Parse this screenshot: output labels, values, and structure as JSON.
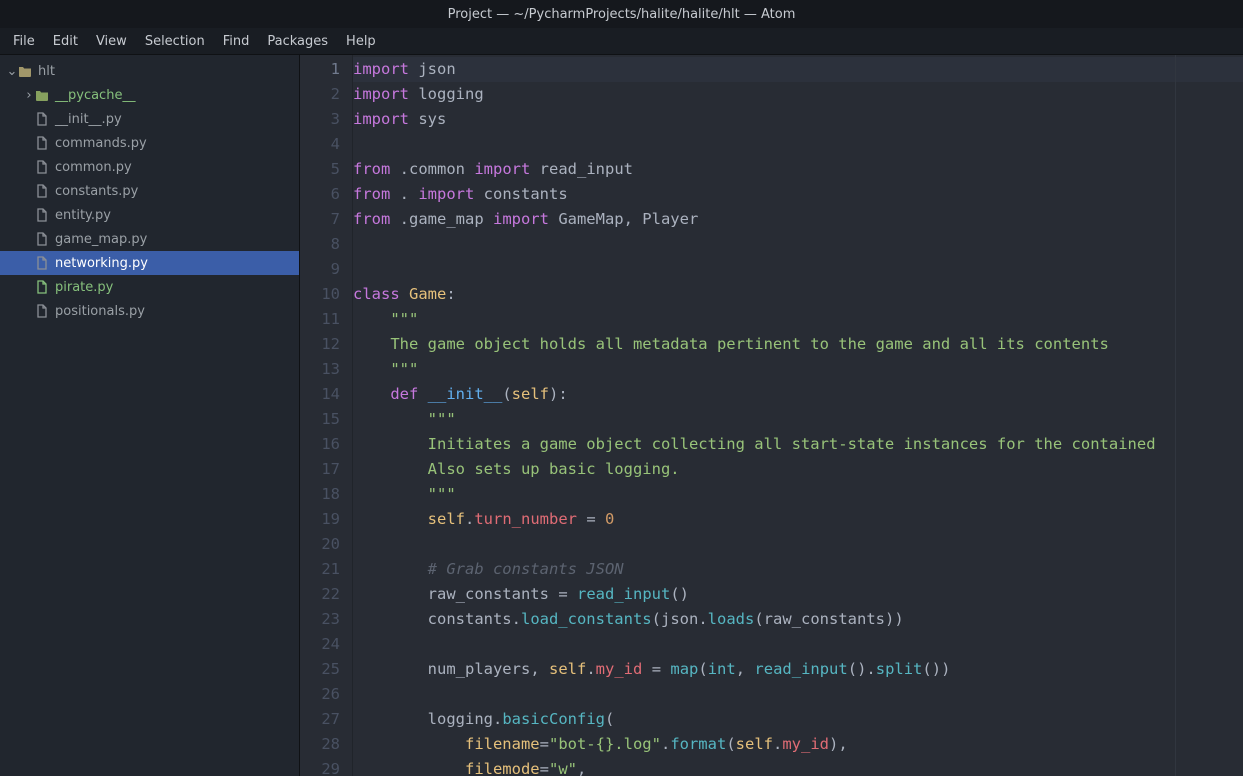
{
  "title": "Project — ~/PycharmProjects/halite/halite/hlt — Atom",
  "menu": [
    "File",
    "Edit",
    "View",
    "Selection",
    "Find",
    "Packages",
    "Help"
  ],
  "tree": {
    "root": {
      "name": "hlt",
      "open": true
    },
    "items": [
      {
        "name": "__pycache__",
        "type": "folder",
        "depth": 1,
        "open": false,
        "modified": true
      },
      {
        "name": "__init__.py",
        "type": "file",
        "depth": 1
      },
      {
        "name": "commands.py",
        "type": "file",
        "depth": 1
      },
      {
        "name": "common.py",
        "type": "file",
        "depth": 1
      },
      {
        "name": "constants.py",
        "type": "file",
        "depth": 1
      },
      {
        "name": "entity.py",
        "type": "file",
        "depth": 1
      },
      {
        "name": "game_map.py",
        "type": "file",
        "depth": 1
      },
      {
        "name": "networking.py",
        "type": "file",
        "depth": 1,
        "selected": true
      },
      {
        "name": "pirate.py",
        "type": "file",
        "depth": 1,
        "modified": true
      },
      {
        "name": "positionals.py",
        "type": "file",
        "depth": 1
      }
    ]
  },
  "editor": {
    "current_line": 1,
    "lines": [
      [
        [
          "kw",
          "import"
        ],
        [
          "def",
          " json"
        ]
      ],
      [
        [
          "kw",
          "import"
        ],
        [
          "def",
          " logging"
        ]
      ],
      [
        [
          "kw",
          "import"
        ],
        [
          "def",
          " sys"
        ]
      ],
      [],
      [
        [
          "kw",
          "from"
        ],
        [
          "def",
          " .common "
        ],
        [
          "kw",
          "import"
        ],
        [
          "def",
          " read_input"
        ]
      ],
      [
        [
          "kw",
          "from"
        ],
        [
          "def",
          " . "
        ],
        [
          "kw",
          "import"
        ],
        [
          "def",
          " constants"
        ]
      ],
      [
        [
          "kw",
          "from"
        ],
        [
          "def",
          " .game_map "
        ],
        [
          "kw",
          "import"
        ],
        [
          "def",
          " GameMap, Player"
        ]
      ],
      [],
      [],
      [
        [
          "kw",
          "class"
        ],
        [
          "def",
          " "
        ],
        [
          "cls",
          "Game"
        ],
        [
          "pun",
          ":"
        ]
      ],
      [
        [
          "def",
          "    "
        ],
        [
          "str",
          "\"\"\""
        ]
      ],
      [
        [
          "def",
          "    "
        ],
        [
          "str",
          "The game object holds all metadata pertinent to the game and all its contents"
        ]
      ],
      [
        [
          "def",
          "    "
        ],
        [
          "str",
          "\"\"\""
        ]
      ],
      [
        [
          "def",
          "    "
        ],
        [
          "kw",
          "def"
        ],
        [
          "def",
          " "
        ],
        [
          "fn",
          "__init__"
        ],
        [
          "pun",
          "("
        ],
        [
          "self",
          "self"
        ],
        [
          "pun",
          "):"
        ]
      ],
      [
        [
          "def",
          "        "
        ],
        [
          "str",
          "\"\"\""
        ]
      ],
      [
        [
          "def",
          "        "
        ],
        [
          "str",
          "Initiates a game object collecting all start-state instances for the contained"
        ]
      ],
      [
        [
          "def",
          "        "
        ],
        [
          "str",
          "Also sets up basic logging."
        ]
      ],
      [
        [
          "def",
          "        "
        ],
        [
          "str",
          "\"\"\""
        ]
      ],
      [
        [
          "def",
          "        "
        ],
        [
          "self",
          "self"
        ],
        [
          "pun",
          "."
        ],
        [
          "attr",
          "turn_number"
        ],
        [
          "def",
          " "
        ],
        [
          "pun",
          "="
        ],
        [
          "def",
          " "
        ],
        [
          "num",
          "0"
        ]
      ],
      [],
      [
        [
          "def",
          "        "
        ],
        [
          "cmt",
          "# Grab constants JSON"
        ]
      ],
      [
        [
          "def",
          "        raw_constants "
        ],
        [
          "pun",
          "="
        ],
        [
          "def",
          " "
        ],
        [
          "call",
          "read_input"
        ],
        [
          "pun",
          "()"
        ]
      ],
      [
        [
          "def",
          "        constants"
        ],
        [
          "pun",
          "."
        ],
        [
          "call",
          "load_constants"
        ],
        [
          "pun",
          "("
        ],
        [
          "def",
          "json"
        ],
        [
          "pun",
          "."
        ],
        [
          "call",
          "loads"
        ],
        [
          "pun",
          "("
        ],
        [
          "def",
          "raw_constants"
        ],
        [
          "pun",
          "))"
        ]
      ],
      [],
      [
        [
          "def",
          "        num_players"
        ],
        [
          "pun",
          ","
        ],
        [
          "def",
          " "
        ],
        [
          "self",
          "self"
        ],
        [
          "pun",
          "."
        ],
        [
          "attr",
          "my_id"
        ],
        [
          "def",
          " "
        ],
        [
          "pun",
          "="
        ],
        [
          "def",
          " "
        ],
        [
          "call",
          "map"
        ],
        [
          "pun",
          "("
        ],
        [
          "blt",
          "int"
        ],
        [
          "pun",
          ","
        ],
        [
          "def",
          " "
        ],
        [
          "call",
          "read_input"
        ],
        [
          "pun",
          "()."
        ],
        [
          "call",
          "split"
        ],
        [
          "pun",
          "())"
        ]
      ],
      [],
      [
        [
          "def",
          "        logging"
        ],
        [
          "pun",
          "."
        ],
        [
          "call",
          "basicConfig"
        ],
        [
          "pun",
          "("
        ]
      ],
      [
        [
          "def",
          "            "
        ],
        [
          "self",
          "filename"
        ],
        [
          "pun",
          "="
        ],
        [
          "str",
          "\"bot-{}.log\""
        ],
        [
          "pun",
          "."
        ],
        [
          "call",
          "format"
        ],
        [
          "pun",
          "("
        ],
        [
          "self",
          "self"
        ],
        [
          "pun",
          "."
        ],
        [
          "attr",
          "my_id"
        ],
        [
          "pun",
          "),"
        ]
      ],
      [
        [
          "def",
          "            "
        ],
        [
          "self",
          "filemode"
        ],
        [
          "pun",
          "="
        ],
        [
          "str",
          "\"w\""
        ],
        [
          "pun",
          ","
        ]
      ]
    ]
  }
}
